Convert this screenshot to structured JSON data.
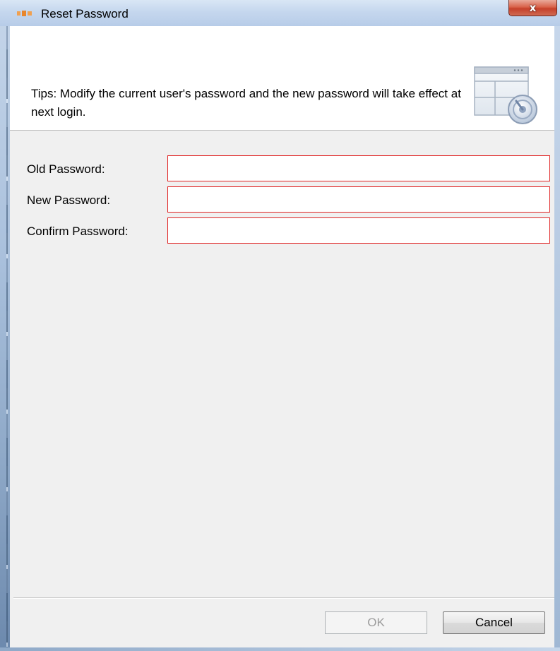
{
  "window": {
    "title": "Reset Password",
    "close_glyph": "x"
  },
  "header": {
    "tips": "Tips: Modify the current user's password and the new password will take effect at next login.",
    "icon": "settings-window-icon"
  },
  "form": {
    "old_password": {
      "label": "Old Password:",
      "value": ""
    },
    "new_password": {
      "label": "New Password:",
      "value": ""
    },
    "confirm_password": {
      "label": "Confirm Password:",
      "value": ""
    }
  },
  "buttons": {
    "ok": "OK",
    "cancel": "Cancel"
  },
  "colors": {
    "invalid_border": "#e02020",
    "panel_bg": "#f0f0f0",
    "close_red": "#c6402a"
  }
}
